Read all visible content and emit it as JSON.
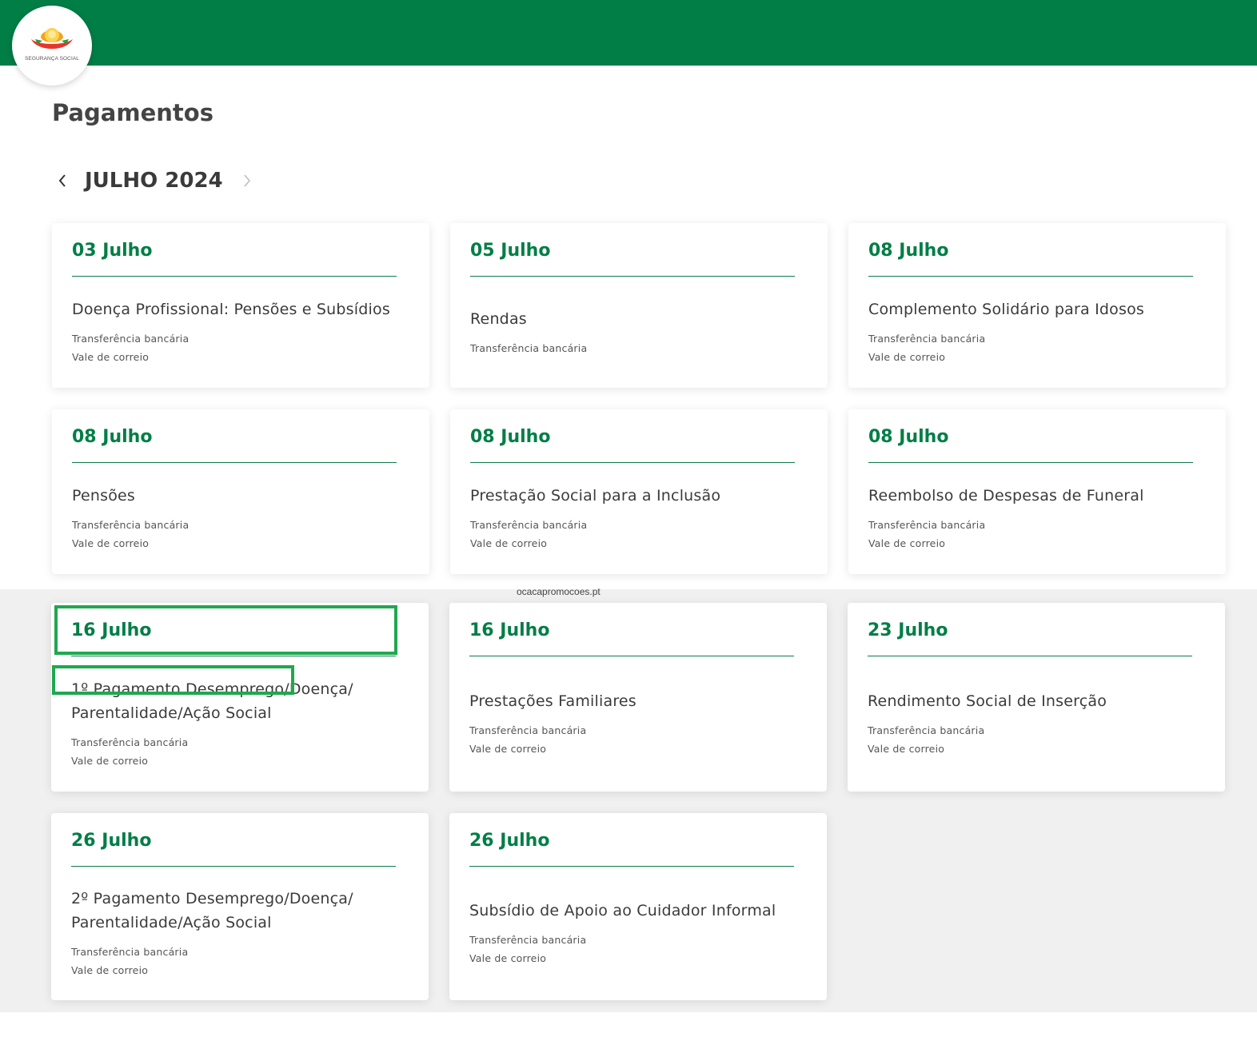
{
  "header": {
    "logo_text": "SEGURANÇA SOCIAL",
    "brand_color": "#007e46",
    "logo_icon": "seguranca-social-logo-icon"
  },
  "page": {
    "title": "Pagamentos"
  },
  "month_nav": {
    "label": "JULHO 2024",
    "prev_icon": "chevron-left-icon",
    "next_icon": "chevron-right-icon"
  },
  "watermark": "ocacapromocoes.pt",
  "cards": [
    {
      "date": "03 Julho",
      "name": "Doença Profissional: Pensões e Subsídios",
      "methods": [
        "Transferência bancária",
        "Vale de correio"
      ]
    },
    {
      "date": "05 Julho",
      "name": "Rendas",
      "methods": [
        "Transferência bancária"
      ]
    },
    {
      "date": "08 Julho",
      "name": "Complemento Solidário para Idosos",
      "methods": [
        "Transferência bancária",
        "Vale de correio"
      ]
    },
    {
      "date": "08 Julho",
      "name": "Pensões",
      "methods": [
        "Transferência bancária",
        "Vale de correio"
      ]
    },
    {
      "date": "08 Julho",
      "name": "Prestação Social para a Inclusão",
      "methods": [
        "Transferência bancária",
        "Vale de correio"
      ]
    },
    {
      "date": "08 Julho",
      "name": "Reembolso de Despesas de Funeral",
      "methods": [
        "Transferência bancária",
        "Vale de correio"
      ]
    },
    {
      "date": "16 Julho",
      "name_lines": [
        "1º Pagamento Desemprego/Doença/",
        "Parentalidade/Ação Social"
      ],
      "methods": [
        "Transferência bancária",
        "Vale de correio"
      ]
    },
    {
      "date": "16 Julho",
      "name": "Prestações Familiares",
      "methods": [
        "Transferência bancária",
        "Vale de correio"
      ]
    },
    {
      "date": "23 Julho",
      "name": "Rendimento Social de Inserção",
      "methods": [
        "Transferência bancária",
        "Vale de correio"
      ]
    },
    {
      "date": "26 Julho",
      "name_lines": [
        "2º Pagamento Desemprego/Doença/",
        "Parentalidade/Ação Social"
      ],
      "methods": [
        "Transferência bancária",
        "Vale de correio"
      ]
    },
    {
      "date": "26 Julho",
      "name": "Subsídio de Apoio ao Cuidador Informal",
      "methods": [
        "Transferência bancária",
        "Vale de correio"
      ]
    }
  ],
  "highlight_color": "#1fa84f"
}
